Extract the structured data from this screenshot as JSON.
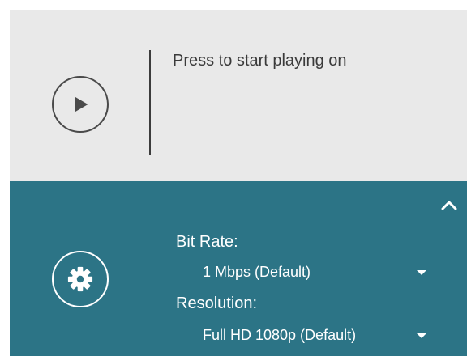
{
  "colors": {
    "play_panel_bg": "#e9e9e9",
    "settings_panel_bg": "#2c7486",
    "icon_dark": "#4a4a4a",
    "text_dark": "#3a3a3a",
    "text_light": "#ffffff"
  },
  "play_panel": {
    "icon": "play-icon",
    "text": "Press to start playing on"
  },
  "settings_panel": {
    "collapse_icon": "chevron-up-icon",
    "icon": "gear-icon",
    "bitrate": {
      "label": "Bit Rate:",
      "value": "1 Mbps (Default)"
    },
    "resolution": {
      "label": "Resolution:",
      "value": "Full HD 1080p (Default)"
    }
  }
}
